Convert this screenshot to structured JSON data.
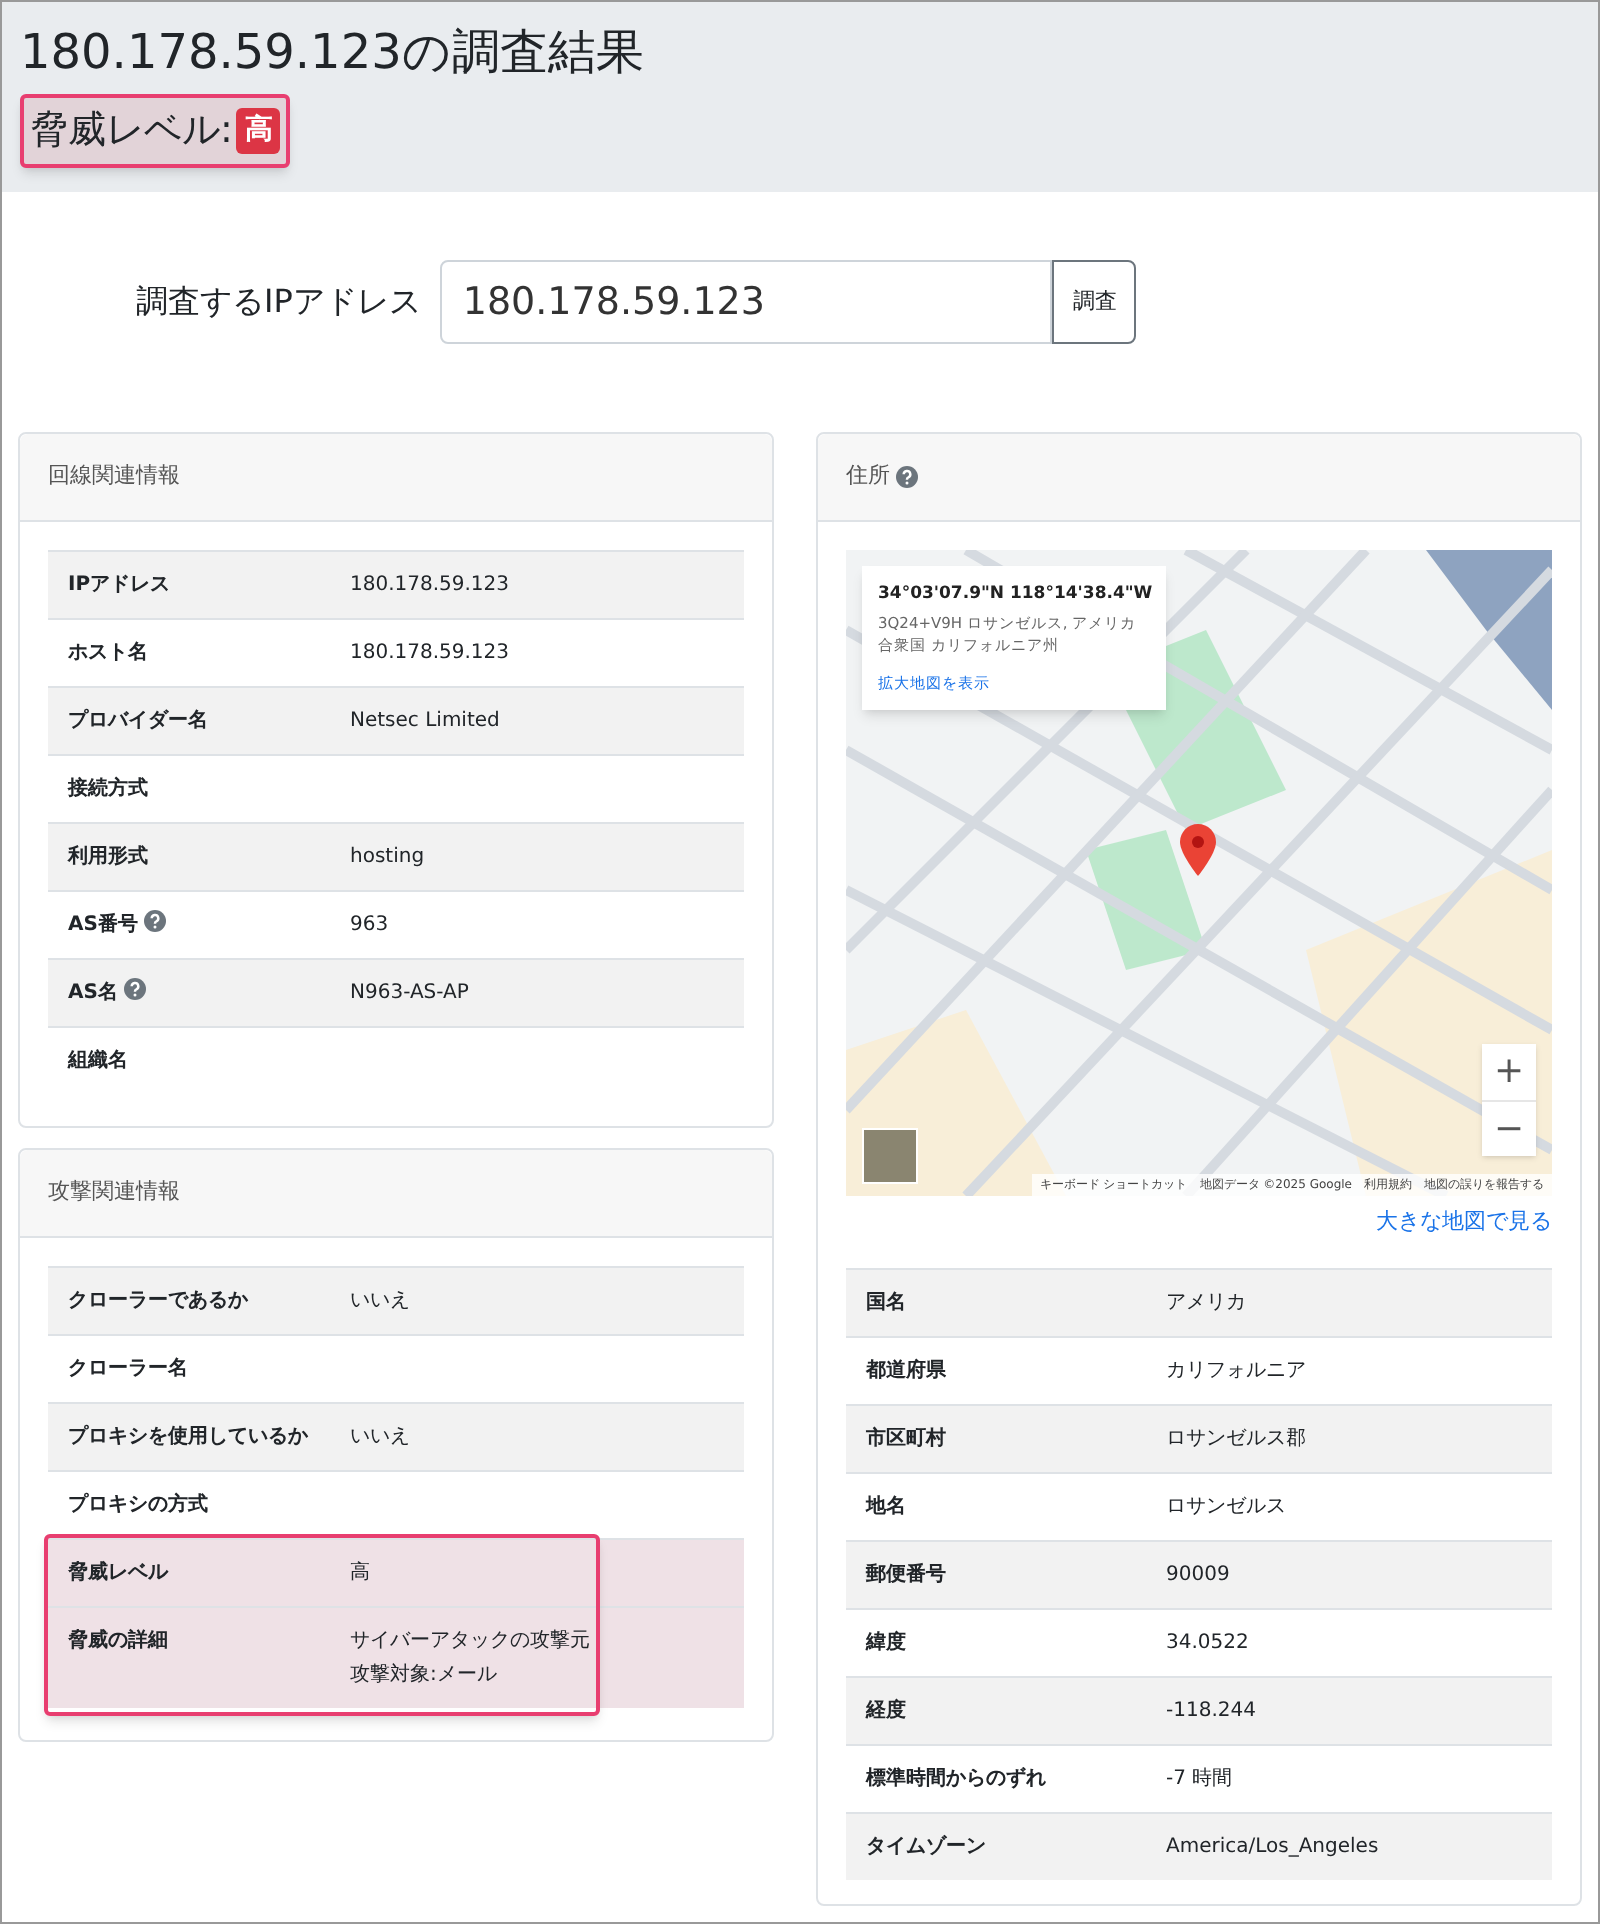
{
  "header": {
    "title": "180.178.59.123の調査結果",
    "threat_label": "脅威レベル:",
    "threat_badge": "高",
    "highlighted": true
  },
  "search": {
    "label": "調査するIPアドレス",
    "value": "180.178.59.123",
    "button": "調査"
  },
  "line_info": {
    "title": "回線関連情報",
    "rows": [
      {
        "label": "IPアドレス",
        "value": "180.178.59.123",
        "help": false,
        "highlighted": false
      },
      {
        "label": "ホスト名",
        "value": "180.178.59.123",
        "help": false,
        "highlighted": false
      },
      {
        "label": "プロバイダー名",
        "value": "Netsec Limited",
        "help": false,
        "highlighted": false
      },
      {
        "label": "接続方式",
        "value": "",
        "help": false,
        "highlighted": false
      },
      {
        "label": "利用形式",
        "value": "hosting",
        "help": false,
        "highlighted": false
      },
      {
        "label": "AS番号",
        "value": "963",
        "help": true,
        "highlighted": false
      },
      {
        "label": "AS名",
        "value": "N963-AS-AP",
        "help": true,
        "highlighted": false
      },
      {
        "label": "組織名",
        "value": "",
        "help": false,
        "highlighted": false
      }
    ]
  },
  "attack_info": {
    "title": "攻撃関連情報",
    "rows": [
      {
        "label": "クローラーであるか",
        "value": "いいえ",
        "help": false,
        "highlighted": false
      },
      {
        "label": "クローラー名",
        "value": "",
        "help": false,
        "highlighted": false
      },
      {
        "label": "プロキシを使用しているか",
        "value": "いいえ",
        "help": false,
        "highlighted": false
      },
      {
        "label": "プロキシの方式",
        "value": "",
        "help": false,
        "highlighted": false
      },
      {
        "label": "脅威レベル",
        "value": "高",
        "help": false,
        "highlighted": true
      },
      {
        "label": "脅威の詳細",
        "value": [
          "サイバーアタックの攻撃元",
          "攻撃対象:メール"
        ],
        "help": false,
        "highlighted": true
      }
    ]
  },
  "address": {
    "title": "住所",
    "help": true,
    "map": {
      "coords": "34°03'07.9\"N 118°14'38.4\"W",
      "place": "3Q24+V9H ロサンゼルス, アメリカ合衆国 カリフォルニア州",
      "enlarge_link": "拡大地図を表示",
      "zoom_in": "+",
      "zoom_out": "−",
      "attribution": [
        "キーボード ショートカット",
        "地図データ ©2025 Google",
        "利用規約",
        "地図の誤りを報告する"
      ]
    },
    "large_map_link": "大きな地図で見る",
    "rows": [
      {
        "label": "国名",
        "value": "アメリカ",
        "help": false,
        "highlighted": false
      },
      {
        "label": "都道府県",
        "value": "カリフォルニア",
        "help": false,
        "highlighted": false
      },
      {
        "label": "市区町村",
        "value": "ロサンゼルス郡",
        "help": false,
        "highlighted": false
      },
      {
        "label": "地名",
        "value": "ロサンゼルス",
        "help": false,
        "highlighted": false
      },
      {
        "label": "郵便番号",
        "value": "90009",
        "help": false,
        "highlighted": false
      },
      {
        "label": "緯度",
        "value": "34.0522",
        "help": false,
        "highlighted": false
      },
      {
        "label": "経度",
        "value": "-118.244",
        "help": false,
        "highlighted": false
      },
      {
        "label": "標準時間からのずれ",
        "value": "-7 時間",
        "help": false,
        "highlighted": false
      },
      {
        "label": "タイムゾーン",
        "value": "America/Los_Angeles",
        "help": false,
        "highlighted": false
      }
    ]
  }
}
